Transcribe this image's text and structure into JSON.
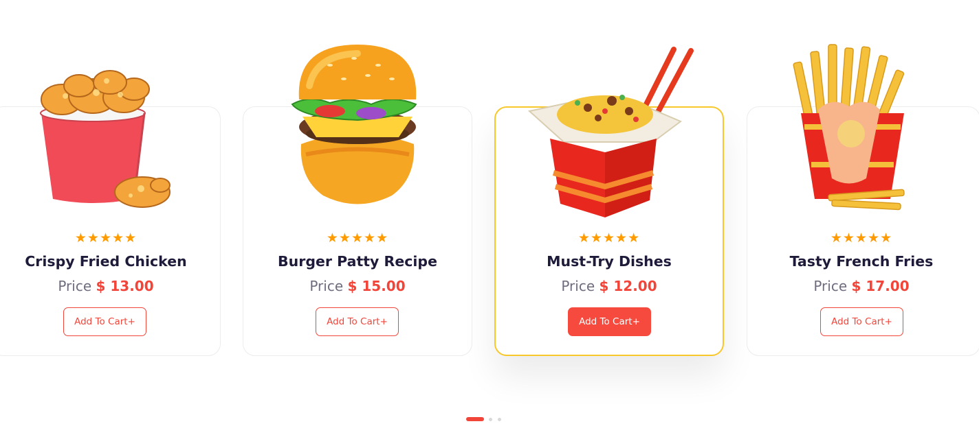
{
  "products": [
    {
      "name": "Crispy Fried Chicken",
      "price_label": "Price",
      "price": "$ 13.00",
      "button": "Add To Cart+",
      "rating": 5,
      "image": "fried-chicken-bucket"
    },
    {
      "name": "Burger Patty Recipe",
      "price_label": "Price",
      "price": "$ 15.00",
      "button": "Add To Cart+",
      "rating": 5,
      "image": "burger"
    },
    {
      "name": "Must-Try Dishes",
      "price_label": "Price",
      "price": "$ 12.00",
      "button": "Add To Cart+",
      "rating": 5,
      "image": "noodle-box"
    },
    {
      "name": "Tasty French Fries",
      "price_label": "Price",
      "price": "$ 17.00",
      "button": "Add To Cart+",
      "rating": 5,
      "image": "french-fries"
    }
  ],
  "active_card": 2,
  "pagination": {
    "pages": 3,
    "current": 1
  },
  "colors": {
    "accent": "#f2453a",
    "star": "#ff9a00",
    "title": "#1d1b39",
    "active_border": "#f8c82a"
  },
  "icons": {
    "star": "star-icon"
  }
}
